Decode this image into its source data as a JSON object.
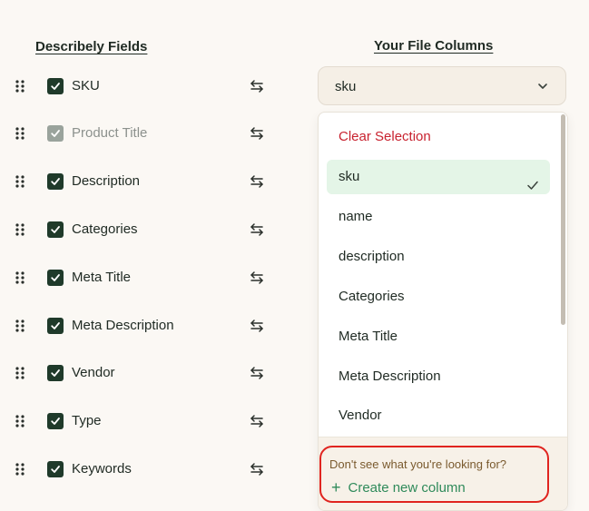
{
  "headers": {
    "left": "Describely Fields",
    "right": "Your File Columns"
  },
  "fields": [
    {
      "label": "SKU",
      "checked": true,
      "disabled": false
    },
    {
      "label": "Product Title",
      "checked": true,
      "disabled": true
    },
    {
      "label": "Description",
      "checked": true,
      "disabled": false
    },
    {
      "label": "Categories",
      "checked": true,
      "disabled": false
    },
    {
      "label": "Meta Title",
      "checked": true,
      "disabled": false
    },
    {
      "label": "Meta Description",
      "checked": true,
      "disabled": false
    },
    {
      "label": "Vendor",
      "checked": true,
      "disabled": false
    },
    {
      "label": "Type",
      "checked": true,
      "disabled": false
    },
    {
      "label": "Keywords",
      "checked": true,
      "disabled": false
    }
  ],
  "select": {
    "value": "sku"
  },
  "dropdown": {
    "clear_label": "Clear Selection",
    "options": [
      "sku",
      "name",
      "description",
      "Categories",
      "Meta Title",
      "Meta Description",
      "Vendor"
    ],
    "selected": "sku",
    "footer_question": "Don't see what you're looking for?",
    "create_label": "Create new column"
  },
  "colors": {
    "checkbox": "#1f3a2a",
    "checkbox_disabled": "#9aa39c",
    "clear_text": "#c8222f",
    "selected_bg": "#e4f5e7",
    "create_text": "#2f8a5a",
    "highlight_border": "#e0241f"
  },
  "icons": {
    "drag": "drag-handle-icon",
    "swap": "swap-arrows-icon",
    "chevron": "chevron-down-icon",
    "check": "check-icon",
    "plus": "plus-icon"
  }
}
